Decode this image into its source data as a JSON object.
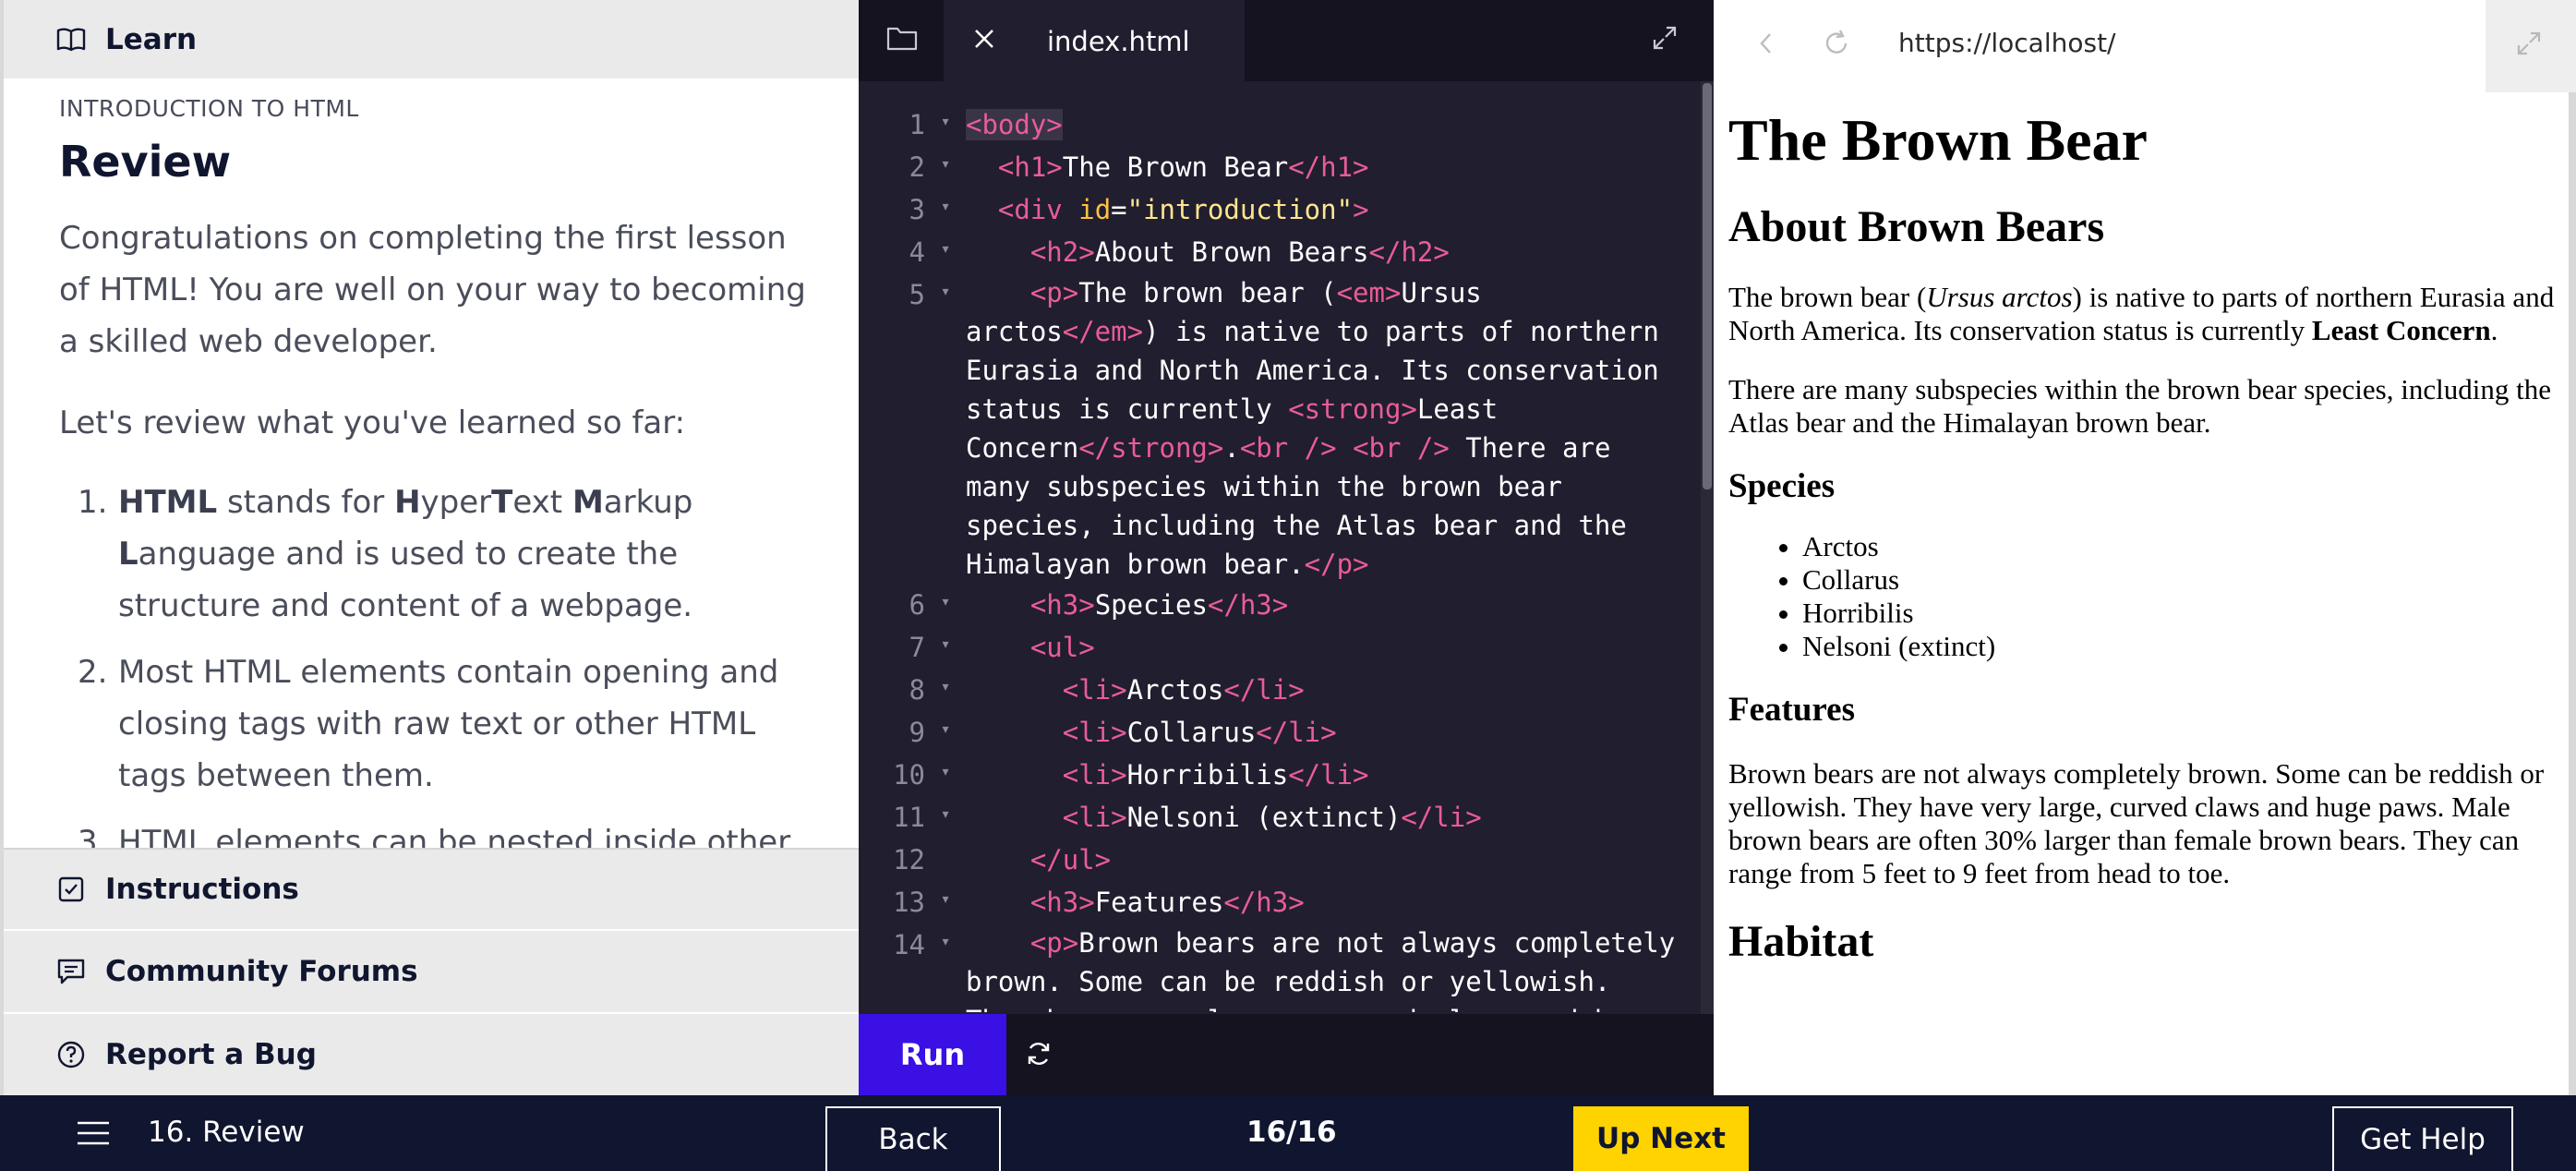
{
  "learn": {
    "header": "Learn",
    "kicker": "INTRODUCTION TO HTML",
    "title": "Review",
    "p1": "Congratulations on completing the first lesson of HTML! You are well on your way to becoming a skilled web developer.",
    "p2": "Let's review what you've learned so far:",
    "items": [
      {
        "num": "1.",
        "parts": [
          {
            "b": "HTML"
          },
          {
            "t": " stands for "
          },
          {
            "b": "H"
          },
          {
            "t": "yper"
          },
          {
            "b": "T"
          },
          {
            "t": "ext "
          },
          {
            "b": "M"
          },
          {
            "t": "arkup "
          },
          {
            "b": "L"
          },
          {
            "t": "anguage and is used to create the structure and content of a webpage."
          }
        ]
      },
      {
        "num": "2.",
        "parts": [
          {
            "t": "Most HTML elements contain opening and closing tags with raw text or other HTML tags between them."
          }
        ]
      },
      {
        "num": "3.",
        "parts": [
          {
            "t": "HTML elements can be nested inside other elements."
          }
        ]
      }
    ],
    "instructions": "Instructions",
    "forums": "Community Forums",
    "bug": "Report a Bug"
  },
  "editor": {
    "file_name": "index.html",
    "run": "Run",
    "lines": [
      {
        "no": "1",
        "fold": true,
        "html": "<span class=\"tg hl\">&lt;body&gt;</span>"
      },
      {
        "no": "2",
        "fold": true,
        "html": "  <span class=\"tg\">&lt;h1&gt;</span>The Brown Bear<span class=\"tg\">&lt;/h1&gt;</span>"
      },
      {
        "no": "3",
        "fold": true,
        "html": "  <span class=\"tg\">&lt;div</span> <span class=\"at\">id</span>=<span class=\"sv\">\"introduction\"</span><span class=\"tg\">&gt;</span>"
      },
      {
        "no": "4",
        "fold": true,
        "html": "    <span class=\"tg\">&lt;h2&gt;</span>About Brown Bears<span class=\"tg\">&lt;/h2&gt;</span>"
      },
      {
        "no": "5",
        "fold": true,
        "wrap": true,
        "html": "    <span class=\"tg\">&lt;p&gt;</span>The brown bear (<span class=\"tg\">&lt;em&gt;</span>Ursus arctos<span class=\"tg\">&lt;/em&gt;</span>) is native to parts of northern Eurasia and North America. Its conservation status is currently <span class=\"tg\">&lt;strong&gt;</span>Least Concern<span class=\"tg\">&lt;/strong&gt;</span>.<span class=\"tg\">&lt;br /&gt;</span> <span class=\"tg\">&lt;br /&gt;</span> There are many subspecies within the brown bear species, including the Atlas bear and the Himalayan brown bear.<span class=\"tg\">&lt;/p&gt;</span>"
      },
      {
        "no": "6",
        "fold": true,
        "html": "    <span class=\"tg\">&lt;h3&gt;</span>Species<span class=\"tg\">&lt;/h3&gt;</span>"
      },
      {
        "no": "7",
        "fold": true,
        "html": "    <span class=\"tg\">&lt;ul&gt;</span>"
      },
      {
        "no": "8",
        "fold": true,
        "html": "      <span class=\"tg\">&lt;li&gt;</span>Arctos<span class=\"tg\">&lt;/li&gt;</span>"
      },
      {
        "no": "9",
        "fold": true,
        "html": "      <span class=\"tg\">&lt;li&gt;</span>Collarus<span class=\"tg\">&lt;/li&gt;</span>"
      },
      {
        "no": "10",
        "fold": true,
        "html": "      <span class=\"tg\">&lt;li&gt;</span>Horribilis<span class=\"tg\">&lt;/li&gt;</span>"
      },
      {
        "no": "11",
        "fold": true,
        "html": "      <span class=\"tg\">&lt;li&gt;</span>Nelsoni (extinct)<span class=\"tg\">&lt;/li&gt;</span>"
      },
      {
        "no": "12",
        "fold": false,
        "html": "    <span class=\"tg\">&lt;/ul&gt;</span>"
      },
      {
        "no": "13",
        "fold": true,
        "html": "    <span class=\"tg\">&lt;h3&gt;</span>Features<span class=\"tg\">&lt;/h3&gt;</span>"
      },
      {
        "no": "14",
        "fold": true,
        "wrap": true,
        "html": "    <span class=\"tg\">&lt;p&gt;</span>Brown bears are not always completely brown. Some can be reddish or yellowish. They have very large, curved claws and huge paws."
      }
    ]
  },
  "browser": {
    "url": "https://localhost/",
    "h1": "The Brown Bear",
    "about_h2": "About Brown Bears",
    "intro_a": "The brown bear (",
    "intro_em": "Ursus arctos",
    "intro_b": ") is native to parts of northern Eurasia and North America. Its conservation status is currently ",
    "intro_strong": "Least Concern",
    "intro_end": ".",
    "subspecies": "There are many subspecies within the brown bear species, including the Atlas bear and the Himalayan brown bear.",
    "species_h3": "Species",
    "species": [
      "Arctos",
      "Collarus",
      "Horribilis",
      "Nelsoni (extinct)"
    ],
    "features_h3": "Features",
    "features_p": "Brown bears are not always completely brown. Some can be reddish or yellowish. They have very large, curved claws and huge paws. Male brown bears are often 30% larger than female brown bears. They can range from 5 feet to 9 feet from head to toe.",
    "habitat_h2": "Habitat"
  },
  "bottom": {
    "lesson": "16. Review",
    "back": "Back",
    "progress": "16/16",
    "next": "Up Next",
    "help": "Get Help"
  },
  "icons": {
    "learn": "book-icon",
    "instructions": "checkbox-icon",
    "forums": "chat-icon",
    "bug": "help-circle-icon",
    "folder": "folder-icon",
    "close": "close-icon",
    "expand": "expand-icon",
    "reset": "refresh-icon",
    "back": "chevron-left-icon",
    "reload": "reload-icon",
    "menu": "hamburger-icon"
  },
  "colors": {
    "run": "#3a10e5",
    "up_next": "#ffd300",
    "navy": "#10162f",
    "tag": "#e85d97"
  }
}
